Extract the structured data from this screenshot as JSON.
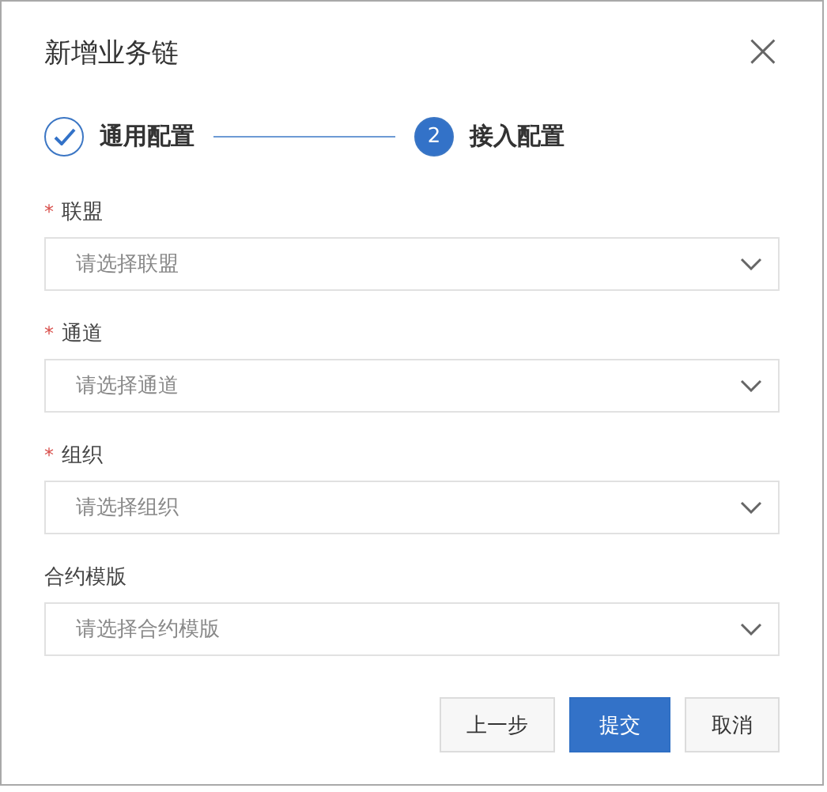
{
  "dialog": {
    "title": "新增业务链",
    "close": "×"
  },
  "steps": [
    {
      "label": "通用配置",
      "completed": true,
      "selected": false
    },
    {
      "label": "接入配置",
      "number": "2",
      "completed": false,
      "selected": true
    }
  ],
  "fields": [
    {
      "label": "联盟",
      "marker": "*",
      "placeholder": "请选择联盟"
    },
    {
      "label": "通道",
      "marker": "*",
      "placeholder": "请选择通道"
    },
    {
      "label": "组织",
      "marker": "*",
      "placeholder": "请选择组织"
    },
    {
      "label": "合约模版",
      "placeholder": "请选择合约模版"
    }
  ],
  "buttons": [
    {
      "label": "上一步",
      "kind": "default"
    },
    {
      "label": "提交",
      "kind": "primary"
    },
    {
      "label": "取消",
      "kind": "default"
    }
  ]
}
